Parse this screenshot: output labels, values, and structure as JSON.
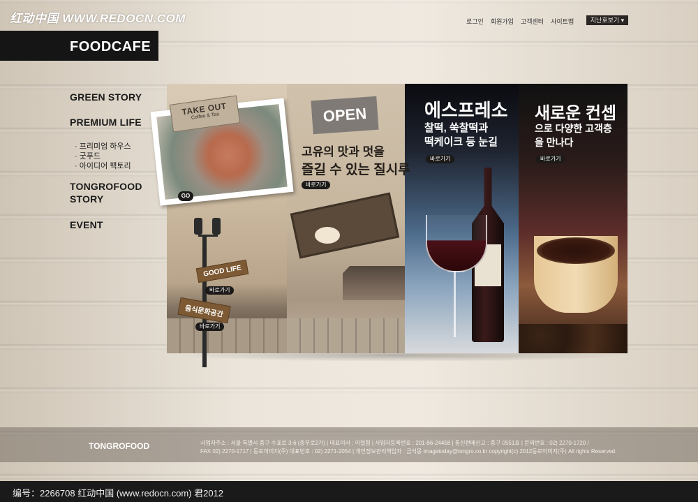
{
  "watermark": "红动中国 WWW.REDOCN.COM",
  "topnav": {
    "items": [
      "로그인",
      "회원가입",
      "고객센터",
      "사이트맵"
    ],
    "family_site": "지난호보기 ▾"
  },
  "logo": "FOODCAFE",
  "menu": {
    "green_story": "GREEN STORY",
    "premium_life": "PREMIUM LIFE",
    "sub": [
      "· 프리미엄 하우스",
      "· 굿푸드",
      "· 아이디어 팩토리"
    ],
    "tongrofood_line1": "TONGROFOOD",
    "tongrofood_line2": "STORY",
    "event": "EVENT"
  },
  "panel1": {
    "takeout_title": "TAKE OUT",
    "takeout_sub": "Coffee & Tea",
    "go_btn": "GO",
    "sign1": "GOOD LIFE",
    "sign1_btn": "바로가기",
    "sign2": "음식문화공간",
    "sign2_btn": "바로가기"
  },
  "panel2": {
    "open_sign": "OPEN",
    "title_line1": "고유의 맛과 멋을",
    "title_line2": "즐길 수 있는 질시루",
    "btn": "바로가기"
  },
  "panel3": {
    "title": "에스프레소",
    "line1": "찰떡, 쑥찰떡과",
    "line2": "떡케이크 등 눈길",
    "btn": "바로가기"
  },
  "panel4": {
    "title": "새로운 컨셉",
    "line1": "으로 다양한 고객층",
    "line2": "을 만나다",
    "btn": "바로가기"
  },
  "footer": {
    "brand": "TONGROFOOD",
    "line1": "사업자주소 : 서울 특별시 중구 수표로 3-6 (충무로2가) | 대표이사 : 이철접 | 사업자등록번호 : 201-86-24458 | 통신판매신고 : 중구 0551호 | 문의번호 : 02) 2270-1720 /",
    "line2": "FAX 02) 2270-1717 | 동로이미지(주) 대표번호 : 02) 2271-2054 | 개인정보관리책임자 : 금석몽 imagetoday@tongro.co.kr  copyright(c) 2012동로이미지(주) All rights Reserved."
  },
  "bottom_bar": "编号：2266708    红动中国 (www.redocn.com)    君2012"
}
